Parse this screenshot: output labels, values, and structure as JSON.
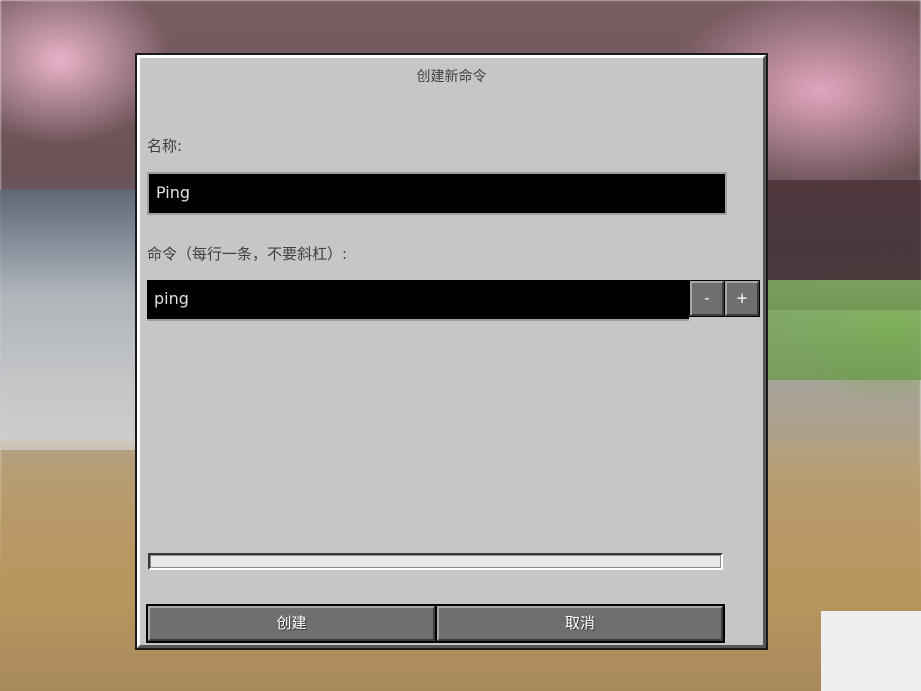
{
  "dialog": {
    "title": "创建新命令",
    "name_label": "名称:",
    "name_value": "Ping",
    "commands_label": "命令（每行一条，不要斜杠）:",
    "commands": [
      {
        "value": "ping",
        "remove_label": "-",
        "add_label": "+"
      }
    ],
    "create_label": "创建",
    "cancel_label": "取消"
  }
}
